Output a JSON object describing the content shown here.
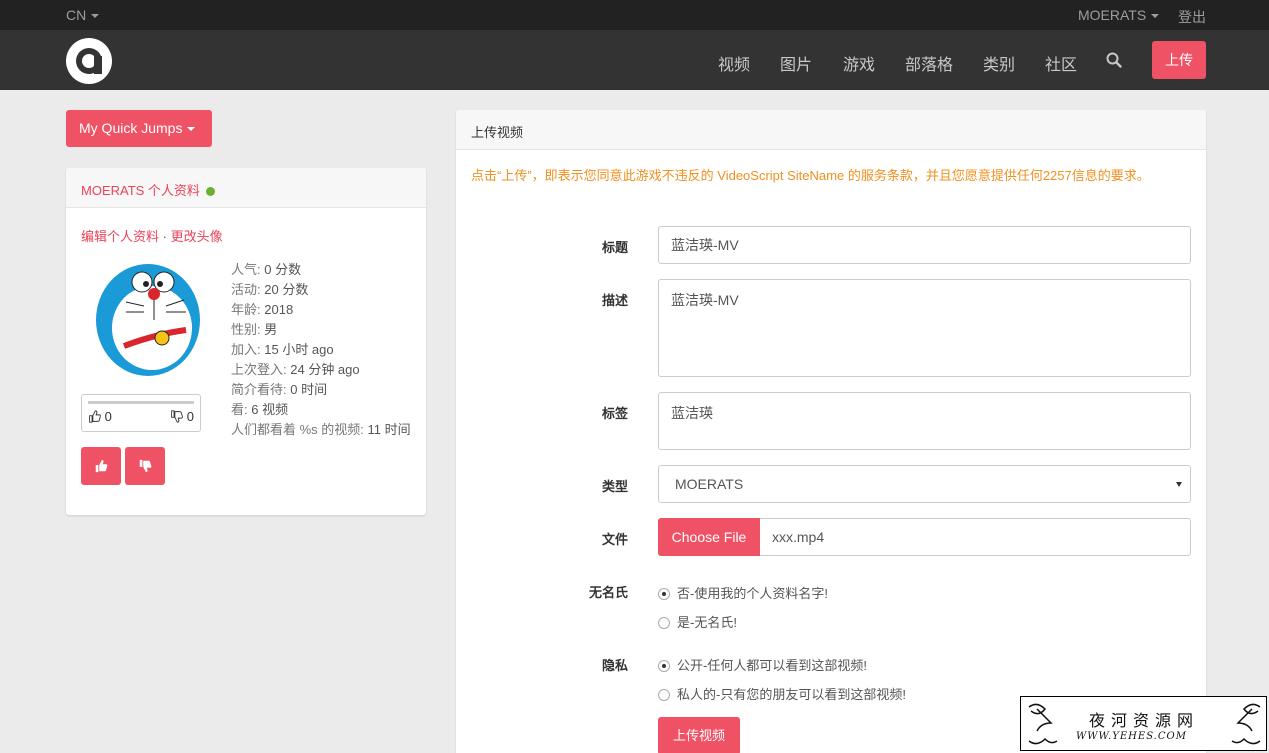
{
  "topbar": {
    "language": "CN",
    "username": "MOERATS",
    "logout": "登出"
  },
  "navbar": {
    "logo_letter": "a",
    "items": [
      "视频",
      "图片",
      "游戏",
      "部落格",
      "类别",
      "社区"
    ],
    "upload_label": "上传"
  },
  "quick_jumps_label": "My Quick Jumps",
  "profile": {
    "title": "MOERATS 个人资料",
    "edit_profile": "编辑个人资料",
    "separator": "·",
    "change_avatar": "更改头像",
    "stats": [
      {
        "label": "人气:",
        "value": "0 分数"
      },
      {
        "label": "活动:",
        "value": "20 分数"
      },
      {
        "label": "年龄:",
        "value": "2018"
      },
      {
        "label": "性别:",
        "value": "男"
      },
      {
        "label": "加入:",
        "value": "15 小时 ago"
      },
      {
        "label": "上次登入:",
        "value": "24 分钟 ago"
      },
      {
        "label": "简介看待:",
        "value": "0 时间"
      },
      {
        "label": "看:",
        "value": "6 视频"
      },
      {
        "label": "人们都看着 %s 的视频:",
        "value": "11 时间"
      }
    ],
    "likes": "0",
    "dislikes": "0"
  },
  "upload": {
    "panel_title": "上传视频",
    "terms": "点击“上传”，即表示您同意此游戏不违反的 VideoScript SiteName 的服务条款，并且您愿意提供任何2257信息的要求。",
    "title_label": "标题",
    "title_value": "蓝洁瑛-MV",
    "desc_label": "描述",
    "desc_value": "蓝洁瑛-MV",
    "tags_label": "标签",
    "tags_value": "蓝洁瑛",
    "type_label": "类型",
    "type_value": "MOERATS",
    "file_label": "文件",
    "choose_file": "Choose File",
    "file_name": "xxx.mp4",
    "anon_label": "无名氏",
    "anon_options": [
      "否-使用我的个人资料名字!",
      "是-无名氏!"
    ],
    "privacy_label": "隐私",
    "privacy_options": [
      "公开-任何人都可以看到这部视频!",
      "私人的-只有您的朋友可以看到这部视频!"
    ],
    "submit_label": "上传视频"
  },
  "watermark": {
    "title": "夜河资源网",
    "url": "WWW.YEHES.COM"
  },
  "colors": {
    "accent": "#f05265",
    "topbar": "#222222",
    "navbar": "#333333",
    "terms": "#f0901e",
    "online": "#6cb033"
  }
}
